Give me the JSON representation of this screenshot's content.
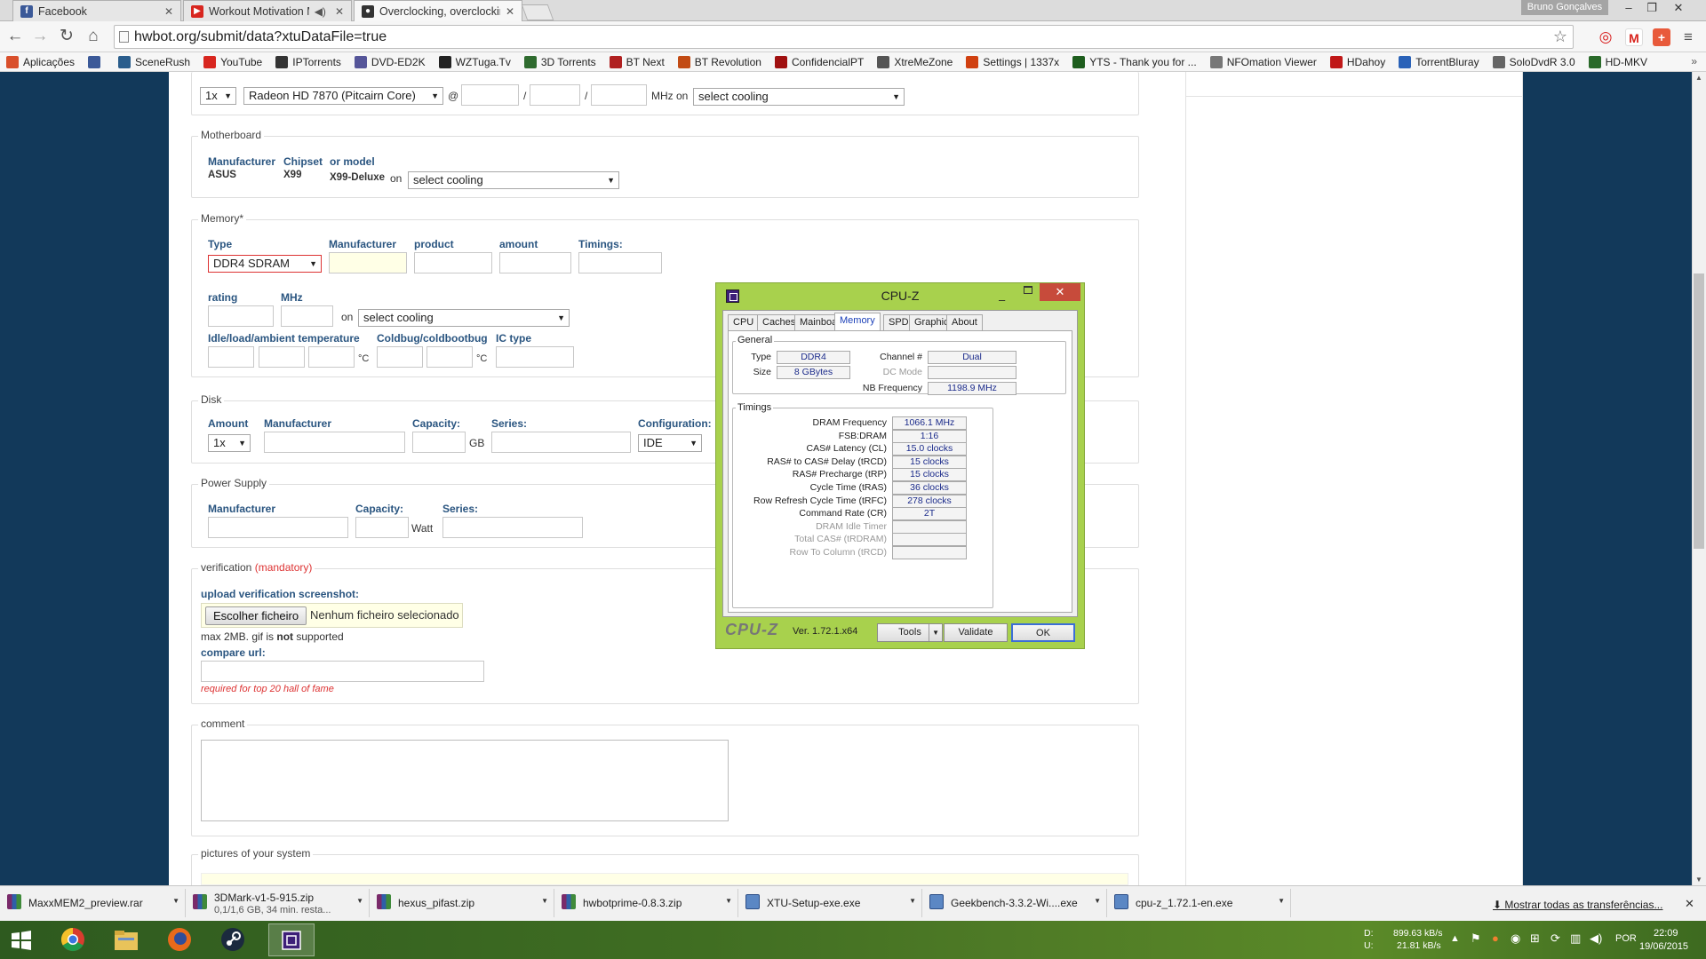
{
  "browser": {
    "tabs": [
      {
        "title": "Facebook",
        "fav": "f",
        "color": "#3b5998"
      },
      {
        "title": "Workout Motivation M",
        "fav": "▶",
        "color": "#d8261f"
      },
      {
        "title": "Overclocking, overclockin",
        "fav": "●",
        "color": "#333333"
      }
    ],
    "user": "Bruno Gonçalves",
    "url": "hwbot.org/submit/data?xtuDataFile=true",
    "bookmarks": [
      {
        "label": "Aplicações",
        "color": "#d94f2b"
      },
      {
        "label": "",
        "color": "#3b5998"
      },
      {
        "label": "SceneRush",
        "color": "#2a5d8c"
      },
      {
        "label": "YouTube",
        "color": "#d8261f"
      },
      {
        "label": "IPTorrents",
        "color": "#333333"
      },
      {
        "label": "DVD-ED2K",
        "color": "#555599"
      },
      {
        "label": "WZTuga.Tv",
        "color": "#222222"
      },
      {
        "label": "3D Torrents",
        "color": "#2f6b2f"
      },
      {
        "label": "BT Next",
        "color": "#b02020"
      },
      {
        "label": "BT Revolution",
        "color": "#c24b14"
      },
      {
        "label": "ConfidencialPT",
        "color": "#a01010"
      },
      {
        "label": "XtreMeZone",
        "color": "#555555"
      },
      {
        "label": "Settings | 1337x",
        "color": "#d04010"
      },
      {
        "label": "YTS - Thank you for ...",
        "color": "#1d5d1d"
      },
      {
        "label": "NFOmation Viewer",
        "color": "#777777"
      },
      {
        "label": "HDahoy",
        "color": "#c01818"
      },
      {
        "label": "TorrentBluray",
        "color": "#2a62b8"
      },
      {
        "label": "SoloDvdR 3.0",
        "color": "#666666"
      },
      {
        "label": "HD-MKV",
        "color": "#2a6a2a"
      }
    ]
  },
  "form": {
    "gpu": {
      "qty": "1x",
      "model": "Radeon HD 7870 (Pitcairn Core)",
      "at": "@",
      "slash1": "/",
      "slash2": "/",
      "mhz_on": "MHz on",
      "cooling": "select cooling"
    },
    "motherboard": {
      "legend": "Motherboard",
      "col_manufacturer": "Manufacturer",
      "col_chipset": "Chipset",
      "col_model": "or model",
      "manufacturer": "ASUS",
      "chipset": "X99",
      "model": "X99-Deluxe",
      "on": "on",
      "cooling": "select cooling"
    },
    "memory": {
      "legend": "Memory*",
      "col_type": "Type",
      "col_manufacturer": "Manufacturer",
      "col_product": "product",
      "col_amount": "amount",
      "col_timings": "Timings:",
      "type": "DDR4 SDRAM",
      "col_rating": "rating",
      "col_mhz": "MHz",
      "on": "on",
      "cooling": "select cooling",
      "col_temp": "Idle/load/ambient temperature",
      "col_coldbug": "Coldbug/coldbootbug",
      "col_ic": "IC type",
      "unit_c": "°C"
    },
    "disk": {
      "legend": "Disk",
      "col_amount": "Amount",
      "col_manufacturer": "Manufacturer",
      "col_capacity": "Capacity:",
      "col_series": "Series:",
      "col_config": "Configuration:",
      "amount": "1x",
      "unit": "GB",
      "config": "IDE"
    },
    "psu": {
      "legend": "Power Supply",
      "col_manufacturer": "Manufacturer",
      "col_capacity": "Capacity:",
      "col_series": "Series:",
      "unit": "Watt"
    },
    "verification": {
      "legend": "verification",
      "mandatory": "(mandatory)",
      "upload_label": "upload verification screenshot:",
      "file_button": "Escolher ficheiro",
      "file_status": "Nenhum ficheiro selecionado",
      "note_a": "max 2MB. gif is ",
      "note_b": "not",
      "note_c": " supported",
      "compare_label": "compare url:",
      "compare_hint": "required for top 20 hall of fame"
    },
    "comment": {
      "legend": "comment"
    },
    "pictures": {
      "legend": "pictures of your system"
    }
  },
  "cpuz": {
    "title": "CPU-Z",
    "tabs": [
      "CPU",
      "Caches",
      "Mainboard",
      "Memory",
      "SPD",
      "Graphics",
      "About"
    ],
    "active_tab": "Memory",
    "general": {
      "legend": "General",
      "type_label": "Type",
      "type": "DDR4",
      "size_label": "Size",
      "size": "8 GBytes",
      "channel_label": "Channel #",
      "channel": "Dual",
      "dcmode_label": "DC Mode",
      "dcmode": "",
      "nbfreq_label": "NB Frequency",
      "nbfreq": "1198.9 MHz"
    },
    "timings": {
      "legend": "Timings",
      "rows": [
        {
          "label": "DRAM Frequency",
          "value": "1066.1 MHz",
          "dim": false
        },
        {
          "label": "FSB:DRAM",
          "value": "1:16",
          "dim": false
        },
        {
          "label": "CAS# Latency (CL)",
          "value": "15.0 clocks",
          "dim": false
        },
        {
          "label": "RAS# to CAS# Delay (tRCD)",
          "value": "15 clocks",
          "dim": false
        },
        {
          "label": "RAS# Precharge (tRP)",
          "value": "15 clocks",
          "dim": false
        },
        {
          "label": "Cycle Time (tRAS)",
          "value": "36 clocks",
          "dim": false
        },
        {
          "label": "Row Refresh Cycle Time (tRFC)",
          "value": "278 clocks",
          "dim": false
        },
        {
          "label": "Command Rate (CR)",
          "value": "2T",
          "dim": false
        },
        {
          "label": "DRAM Idle Timer",
          "value": "",
          "dim": true
        },
        {
          "label": "Total CAS# (tRDRAM)",
          "value": "",
          "dim": true
        },
        {
          "label": "Row To Column (tRCD)",
          "value": "",
          "dim": true
        }
      ]
    },
    "footer": {
      "logo": "CPU-Z",
      "version": "Ver. 1.72.1.x64",
      "tools": "Tools",
      "validate": "Validate",
      "ok": "OK"
    }
  },
  "downloads": {
    "items": [
      {
        "name": "MaxxMEM2_preview.rar",
        "sub": "",
        "icon": "rar"
      },
      {
        "name": "3DMark-v1-5-915.zip",
        "sub": "0,1/1,6 GB, 34 min. resta...",
        "icon": "rar"
      },
      {
        "name": "hexus_pifast.zip",
        "sub": "",
        "icon": "rar"
      },
      {
        "name": "hwbotprime-0.8.3.zip",
        "sub": "",
        "icon": "rar"
      },
      {
        "name": "XTU-Setup-exe.exe",
        "sub": "",
        "icon": "exe"
      },
      {
        "name": "Geekbench-3.3.2-Wi....exe",
        "sub": "",
        "icon": "exe"
      },
      {
        "name": "cpu-z_1.72.1-en.exe",
        "sub": "",
        "icon": "exe"
      }
    ],
    "show_all": "Mostrar todas as transferências..."
  },
  "taskbar": {
    "net_d_label": "D:",
    "net_d": "899.63 kB/s",
    "net_u_label": "U:",
    "net_u": "21.81 kB/s",
    "lang": "POR",
    "time": "22:09",
    "date": "19/06/2015"
  }
}
